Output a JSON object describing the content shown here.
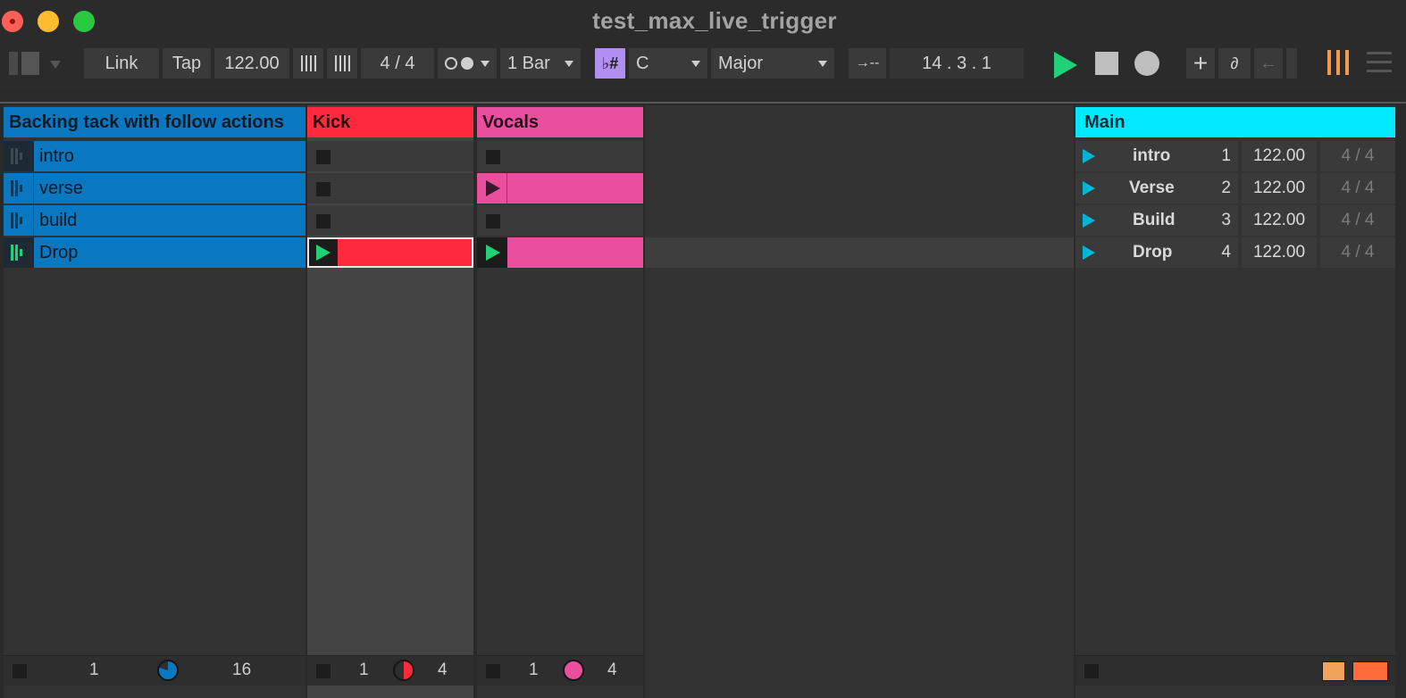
{
  "window": {
    "title": "test_max_live_trigger"
  },
  "toolbar": {
    "link_label": "Link",
    "tap_label": "Tap",
    "tempo": "122.00",
    "time_signature": "4 / 4",
    "quantization": "1 Bar",
    "scale_mode_icon": "♭#",
    "key": "C",
    "scale": "Major",
    "position": "14 .  3 .  1",
    "accent_color": "#21d178",
    "icons": [
      "view-toggle-icon",
      "nudge-down-icon",
      "nudge-up-icon",
      "metronome-icon",
      "scale-mode-icon",
      "follow-icon",
      "play-icon",
      "stop-icon",
      "record-icon",
      "add-icon",
      "link-automation-icon",
      "back-arrow-icon",
      "cpu-meter-icon",
      "menu-icon"
    ]
  },
  "tracks": [
    {
      "name": "Backing tack with follow actions",
      "color": "#0a78c0",
      "clips": [
        {
          "name": "intro",
          "state": "stopped"
        },
        {
          "name": "verse",
          "state": "stopped"
        },
        {
          "name": "build",
          "state": "stopped"
        },
        {
          "name": "Drop",
          "state": "playing"
        }
      ],
      "footer": {
        "start": "1",
        "end": "16"
      }
    },
    {
      "name": "Kick",
      "color": "#ff2a3d",
      "clips": [
        {
          "name": "",
          "state": "empty"
        },
        {
          "name": "",
          "state": "empty"
        },
        {
          "name": "",
          "state": "empty"
        },
        {
          "name": "",
          "state": "playing"
        }
      ],
      "footer": {
        "start": "1",
        "end": "4"
      }
    },
    {
      "name": "Vocals",
      "color": "#ea4f9e",
      "clips": [
        {
          "name": "",
          "state": "empty"
        },
        {
          "name": "",
          "state": "stopped"
        },
        {
          "name": "",
          "state": "empty"
        },
        {
          "name": "",
          "state": "playing"
        }
      ],
      "footer": {
        "start": "1",
        "end": "4"
      }
    }
  ],
  "master": {
    "name": "Main",
    "color": "#00e9ff",
    "scenes": [
      {
        "name": "intro",
        "number": "1",
        "tempo": "122.00",
        "signature": "4 / 4"
      },
      {
        "name": "Verse",
        "number": "2",
        "tempo": "122.00",
        "signature": "4 / 4"
      },
      {
        "name": "Build",
        "number": "3",
        "tempo": "122.00",
        "signature": "4 / 4"
      },
      {
        "name": "Drop",
        "number": "4",
        "tempo": "122.00",
        "signature": "4 / 4"
      }
    ]
  }
}
